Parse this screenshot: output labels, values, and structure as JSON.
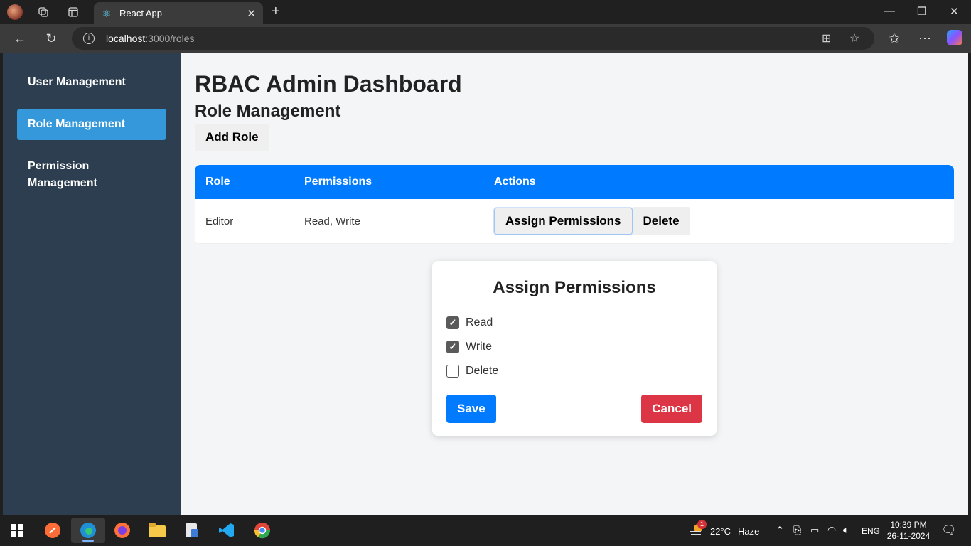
{
  "browser": {
    "tab_title": "React App",
    "url_host": "localhost",
    "url_path": ":3000/roles",
    "icons": {
      "profile": "profile-avatar",
      "workspaces": "workspaces-icon",
      "tab_actions": "tab-actions-icon",
      "tab_favicon": "react-icon",
      "close_tab": "close-icon",
      "new_tab": "plus-icon",
      "back": "back-arrow-icon",
      "refresh": "refresh-icon",
      "site_info": "info-icon",
      "app_available": "app-icon",
      "favorite": "star-icon",
      "favorites": "favorites-icon",
      "more": "more-icon",
      "copilot": "copilot-icon"
    }
  },
  "sidebar": {
    "items": [
      {
        "label": "User Management",
        "active": false
      },
      {
        "label": "Role Management",
        "active": true
      },
      {
        "label": "Permission Management",
        "active": false
      }
    ]
  },
  "main": {
    "title": "RBAC Admin Dashboard",
    "section_title": "Role Management",
    "add_role_label": "Add Role",
    "table": {
      "headers": [
        "Role",
        "Permissions",
        "Actions"
      ],
      "rows": [
        {
          "role": "Editor",
          "permissions": "Read, Write",
          "assign_label": "Assign Permissions",
          "delete_label": "Delete"
        }
      ]
    }
  },
  "modal": {
    "title": "Assign Permissions",
    "options": [
      {
        "label": "Read",
        "checked": true
      },
      {
        "label": "Write",
        "checked": true
      },
      {
        "label": "Delete",
        "checked": false
      }
    ],
    "save_label": "Save",
    "cancel_label": "Cancel"
  },
  "taskbar": {
    "weather_temp": "22°C",
    "weather_desc": "Haze",
    "weather_badge": "1",
    "language": "ENG",
    "time": "10:39 PM",
    "date": "26-11-2024"
  },
  "colors": {
    "sidebar_bg": "#2c3e50",
    "sidebar_active": "#3498db",
    "table_header": "#007bff",
    "save": "#007bff",
    "cancel": "#dc3545"
  }
}
